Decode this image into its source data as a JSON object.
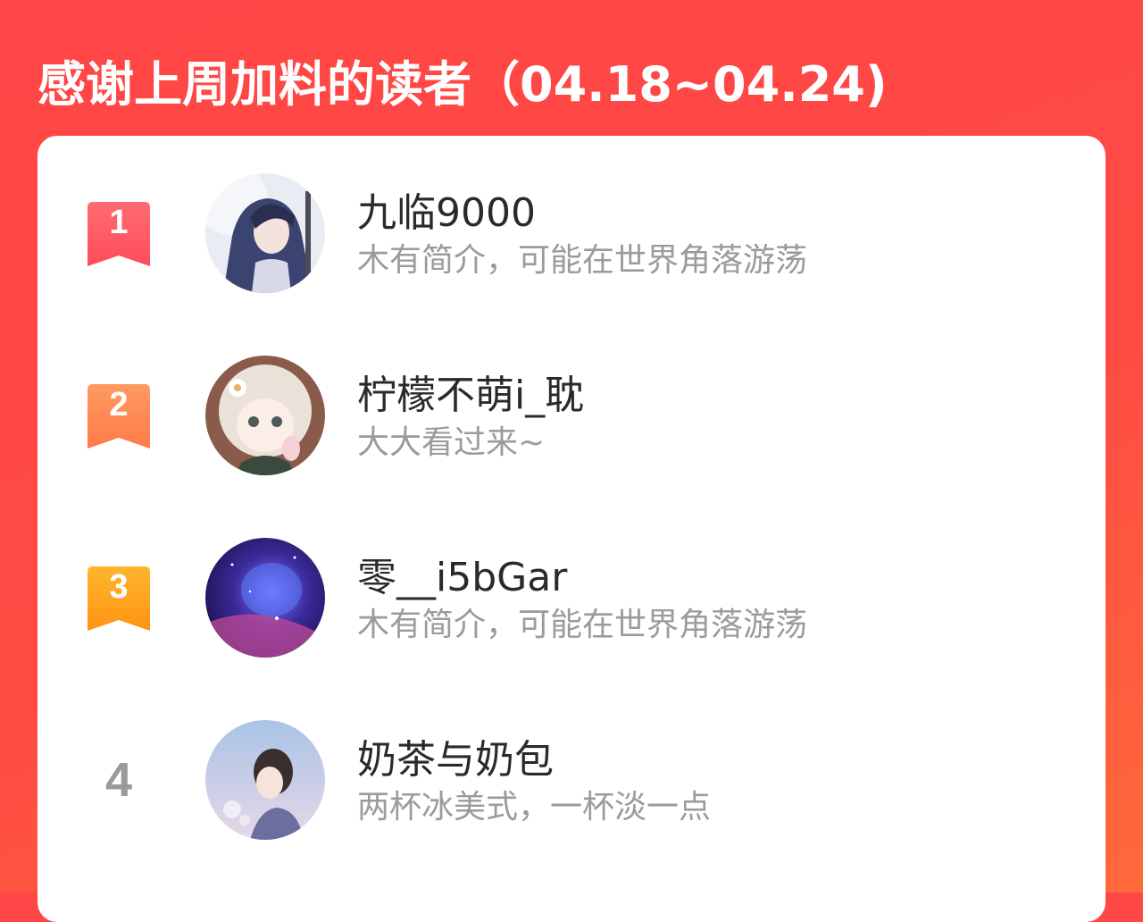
{
  "header": {
    "title": "感谢上周加料的读者（04.18~04.24)"
  },
  "readers": [
    {
      "rank": "1",
      "name": "九临9000",
      "bio": "木有简介，可能在世界角落游荡",
      "badge_color": "#ff5a64"
    },
    {
      "rank": "2",
      "name": "柠檬不萌i_耽",
      "bio": "大大看过来~",
      "badge_color": "#ff8a55"
    },
    {
      "rank": "3",
      "name": "零__i5bGar",
      "bio": "木有简介，可能在世界角落游荡",
      "badge_color": "#ffa31f"
    },
    {
      "rank": "4",
      "name": "奶茶与奶包",
      "bio": "两杯冰美式，一杯淡一点"
    }
  ],
  "colors": {
    "background": "#ff4646",
    "card": "#ffffff",
    "name_text": "#2a2a2a",
    "bio_text": "#9b9b9b",
    "plain_rank": "#9a9a9a"
  },
  "icons": {
    "rank_badge": "bookmark-ribbon-icon"
  }
}
